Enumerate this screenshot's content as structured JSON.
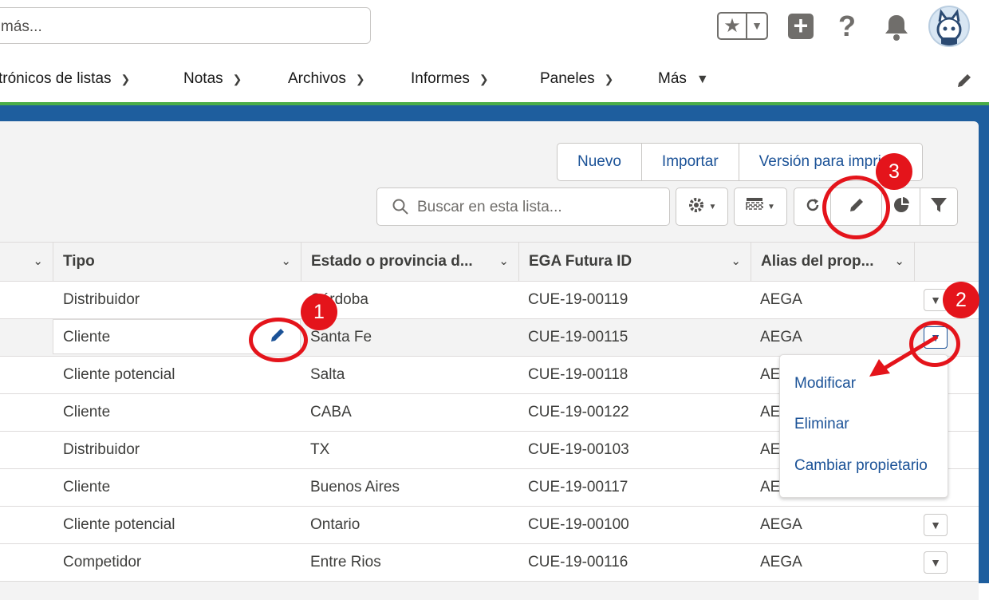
{
  "header": {
    "search_placeholder": "más...",
    "favorites_icon": "star-icon",
    "add_icon": "plus-icon",
    "help_icon": "question-icon",
    "help_label": "?",
    "notifications_icon": "bell-icon"
  },
  "nav": {
    "items": [
      {
        "label": "trónicos de listas"
      },
      {
        "label": "Notas"
      },
      {
        "label": "Archivos"
      },
      {
        "label": "Informes"
      },
      {
        "label": "Paneles"
      },
      {
        "label": "Más"
      }
    ]
  },
  "toolbar": {
    "buttons": [
      "Nuevo",
      "Importar",
      "Versión para imprimir"
    ],
    "search_placeholder": "Buscar en esta lista..."
  },
  "table": {
    "columns": [
      "Tipo",
      "Estado o provincia d...",
      "EGA Futura ID",
      "Alias del prop..."
    ],
    "rows": [
      {
        "tipo": "Distribuidor",
        "estado": "Córdoba",
        "id": "CUE-19-00119",
        "alias": "AEGA"
      },
      {
        "tipo": "Cliente",
        "estado": "Santa Fe",
        "id": "CUE-19-00115",
        "alias": "AEGA"
      },
      {
        "tipo": "Cliente potencial",
        "estado": "Salta",
        "id": "CUE-19-00118",
        "alias": "AE"
      },
      {
        "tipo": "Cliente",
        "estado": "CABA",
        "id": "CUE-19-00122",
        "alias": "AE"
      },
      {
        "tipo": "Distribuidor",
        "estado": "TX",
        "id": "CUE-19-00103",
        "alias": "AE"
      },
      {
        "tipo": "Cliente",
        "estado": "Buenos Aires",
        "id": "CUE-19-00117",
        "alias": "AE"
      },
      {
        "tipo": "Cliente potencial",
        "estado": "Ontario",
        "id": "CUE-19-00100",
        "alias": "AEGA"
      },
      {
        "tipo": "Competidor",
        "estado": "Entre Rios",
        "id": "CUE-19-00116",
        "alias": "AEGA"
      }
    ]
  },
  "row_menu": {
    "items": [
      "Modificar",
      "Eliminar",
      "Cambiar propietario"
    ]
  },
  "annotations": {
    "badges": [
      "1",
      "2",
      "3"
    ],
    "color": "#e4141b"
  },
  "colors": {
    "brand_blue": "#1e5e9e",
    "accent_green": "#4bad48",
    "link_blue": "#1b5297"
  }
}
